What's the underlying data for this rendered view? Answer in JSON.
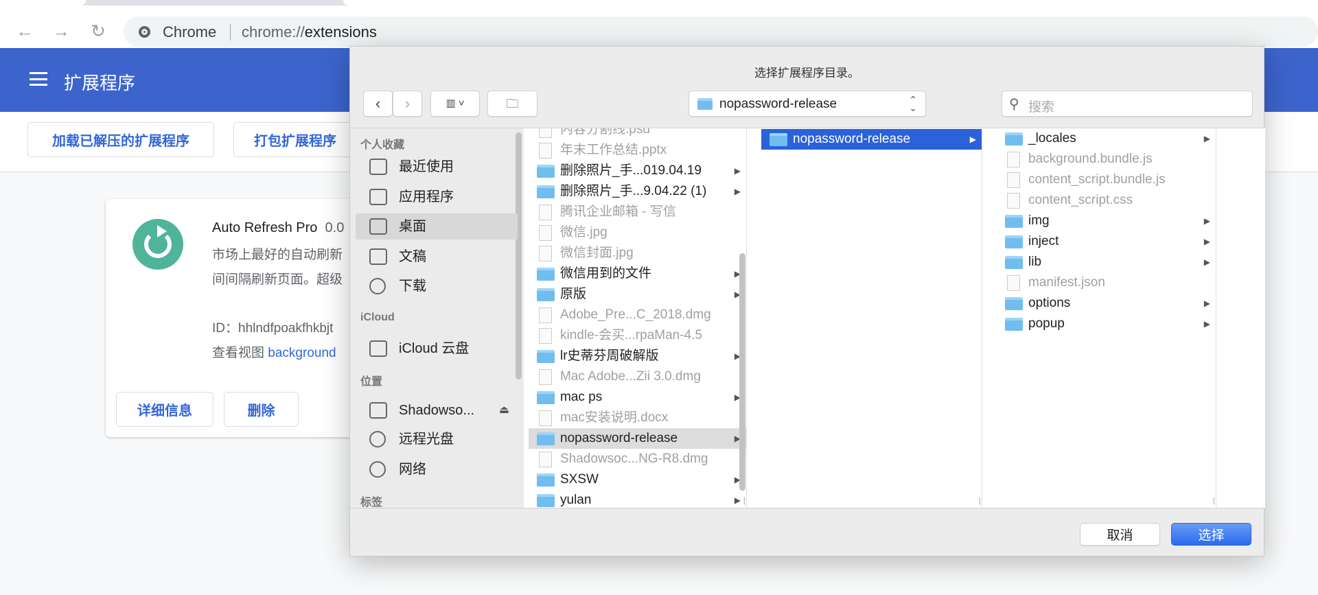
{
  "browser": {
    "back_icon": "←",
    "forward_icon": "→",
    "reload_icon": "↻",
    "site_label": "Chrome",
    "url_prefix": "chrome://",
    "url_path": "extensions"
  },
  "header": {
    "title": "扩展程序"
  },
  "actions": {
    "load_unpacked": "加载已解压的扩展程序",
    "pack": "打包扩展程序"
  },
  "extension": {
    "name": "Auto Refresh Pro",
    "version": "0.0",
    "desc_line1": "市场上最好的自动刷新",
    "desc_line2": "间间隔刷新页面。超级",
    "id": "ID：hhlndfpoakfhkbjt",
    "views_label": "查看视图",
    "views_link": "background",
    "details": "详细信息",
    "remove": "删除",
    "icon_color": "#4fb49a"
  },
  "dialog": {
    "title": "选择扩展程序目录。",
    "path": "nopassword-release",
    "search_placeholder": "搜索",
    "cancel": "取消",
    "choose": "选择",
    "accent": "#2a62d9",
    "sidebar": [
      {
        "type": "head",
        "label": "个人收藏"
      },
      {
        "type": "item",
        "label": "最近使用",
        "icon": "recents-icon"
      },
      {
        "type": "item",
        "label": "应用程序",
        "icon": "applications-icon"
      },
      {
        "type": "item",
        "label": "桌面",
        "icon": "desktop-icon",
        "selected": true
      },
      {
        "type": "item",
        "label": "文稿",
        "icon": "documents-icon"
      },
      {
        "type": "item",
        "label": "下载",
        "icon": "downloads-icon"
      },
      {
        "type": "head",
        "label": "iCloud"
      },
      {
        "type": "item",
        "label": "iCloud 云盘",
        "icon": "cloud-icon"
      },
      {
        "type": "head",
        "label": "位置"
      },
      {
        "type": "item",
        "label": "Shadowso...",
        "icon": "disk-icon",
        "eject": "⏏"
      },
      {
        "type": "item",
        "label": "远程光盘",
        "icon": "disc-icon"
      },
      {
        "type": "item",
        "label": "网络",
        "icon": "network-icon"
      },
      {
        "type": "head",
        "label": "标签"
      }
    ],
    "column1": [
      {
        "name": "内容分割线.psd",
        "kind": "file"
      },
      {
        "name": "年末工作总结.pptx",
        "kind": "file"
      },
      {
        "name": "删除照片_手...019.04.19",
        "kind": "folder"
      },
      {
        "name": "删除照片_手...9.04.22 (1)",
        "kind": "folder"
      },
      {
        "name": "腾讯企业邮箱 - 写信",
        "kind": "file"
      },
      {
        "name": "微信.jpg",
        "kind": "file"
      },
      {
        "name": "微信封面.jpg",
        "kind": "file"
      },
      {
        "name": "微信用到的文件",
        "kind": "folder"
      },
      {
        "name": "原版",
        "kind": "folder"
      },
      {
        "name": "Adobe_Pre...C_2018.dmg",
        "kind": "file"
      },
      {
        "name": "kindle-会买...rpaMan-4.5",
        "kind": "file"
      },
      {
        "name": "lr史蒂芬周破解版",
        "kind": "folder"
      },
      {
        "name": "Mac Adobe...Zii 3.0.dmg",
        "kind": "file"
      },
      {
        "name": "mac ps",
        "kind": "folder"
      },
      {
        "name": "mac安装说明.docx",
        "kind": "file"
      },
      {
        "name": "nopassword-release",
        "kind": "folder",
        "selected": true
      },
      {
        "name": "Shadowsoc...NG-R8.dmg",
        "kind": "file"
      },
      {
        "name": "SXSW",
        "kind": "folder"
      },
      {
        "name": "yulan",
        "kind": "folder"
      }
    ],
    "column2": [
      {
        "name": "nopassword-release",
        "kind": "folder",
        "active": true
      }
    ],
    "column3": [
      {
        "name": "_locales",
        "kind": "folder"
      },
      {
        "name": "background.bundle.js",
        "kind": "file"
      },
      {
        "name": "content_script.bundle.js",
        "kind": "file"
      },
      {
        "name": "content_script.css",
        "kind": "file"
      },
      {
        "name": "img",
        "kind": "folder"
      },
      {
        "name": "inject",
        "kind": "folder"
      },
      {
        "name": "lib",
        "kind": "folder"
      },
      {
        "name": "manifest.json",
        "kind": "file"
      },
      {
        "name": "options",
        "kind": "folder"
      },
      {
        "name": "popup",
        "kind": "folder"
      }
    ]
  }
}
